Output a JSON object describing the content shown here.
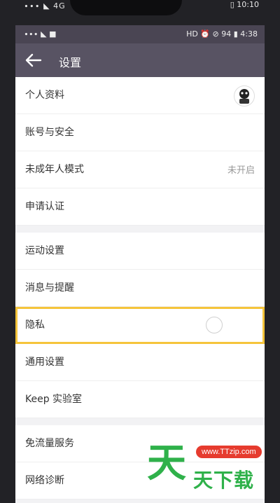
{
  "outer_status": {
    "left": "∙∙∙ ◣ 4G",
    "right": "▯ 10:10"
  },
  "inner_status": {
    "left": "∙∙∙ ◣ ■",
    "right": "HD ⏰ ⊘ 94 ▮ 4:38"
  },
  "header": {
    "title": "设置"
  },
  "rows": [
    {
      "label": "个人资料"
    },
    {
      "label": "账号与安全"
    },
    {
      "label": "未成年人模式",
      "value": "未开启"
    },
    {
      "label": "申请认证"
    },
    {
      "label": "运动设置"
    },
    {
      "label": "消息与提醒"
    },
    {
      "label": "隐私"
    },
    {
      "label": "通用设置"
    },
    {
      "label": "Keep 实验室"
    },
    {
      "label": "免流量服务"
    },
    {
      "label": "网络诊断"
    }
  ],
  "watermark": {
    "url": "www.TTzip.com",
    "char": "天",
    "text": "天下载"
  },
  "colors": {
    "header_bg": "#585363",
    "highlight": "#f5c43b",
    "watermark_green": "#2fb14a",
    "watermark_red": "#e63b2e"
  }
}
